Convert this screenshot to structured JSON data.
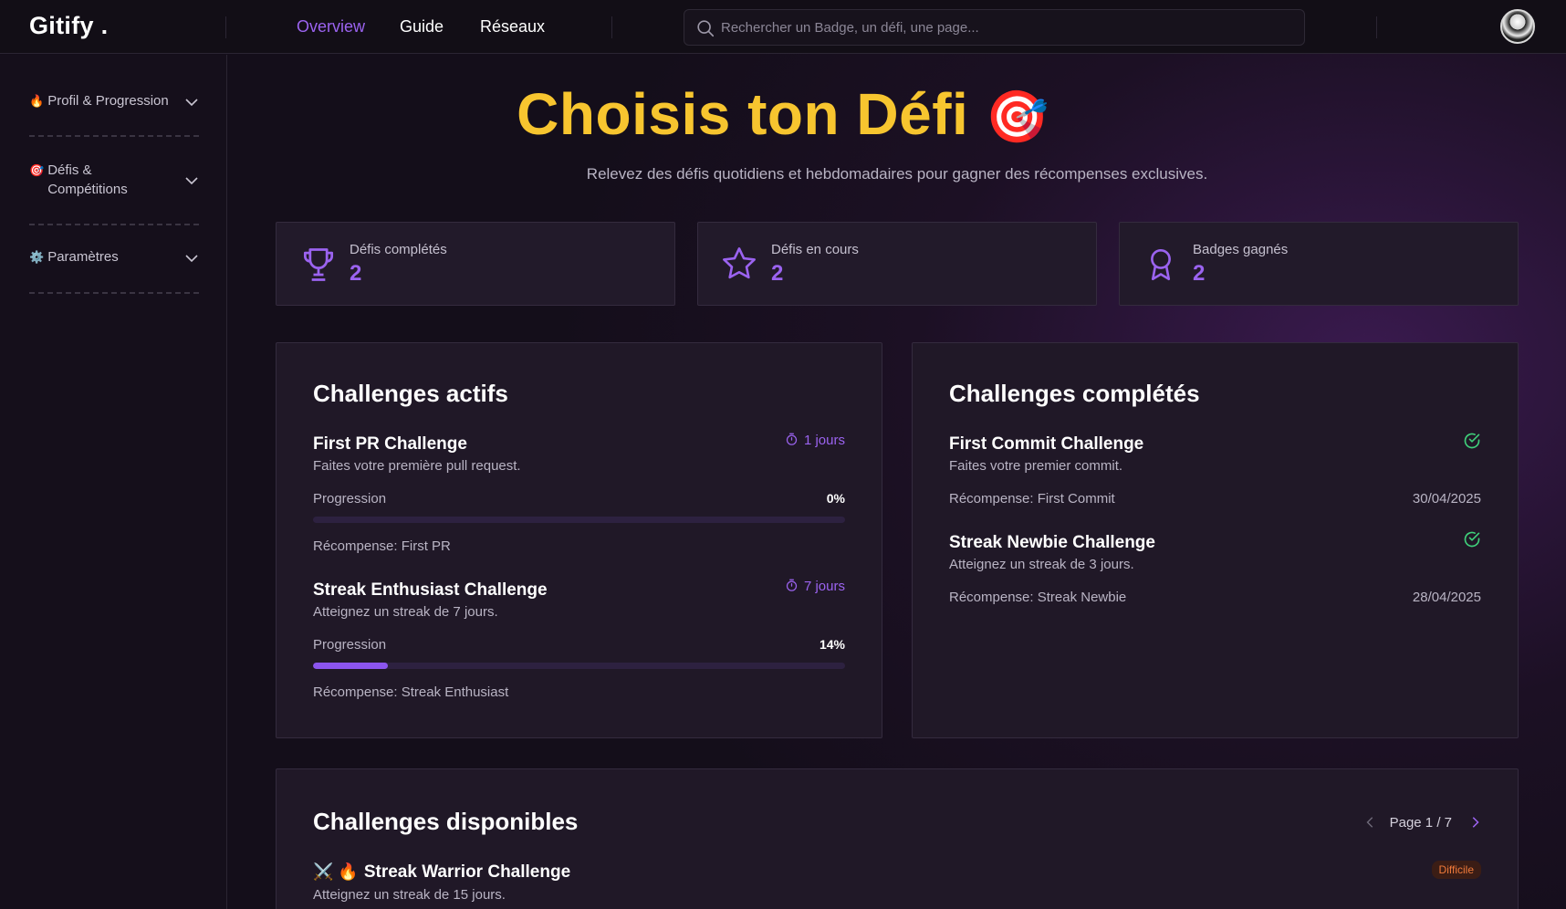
{
  "app": {
    "logo": "Gitify ."
  },
  "nav": {
    "items": [
      {
        "label": "Overview",
        "active": true
      },
      {
        "label": "Guide"
      },
      {
        "label": "Réseaux"
      }
    ]
  },
  "search": {
    "placeholder": "Rechercher un Badge, un défi, une page..."
  },
  "sidebar": {
    "items": [
      {
        "emoji": "🔥",
        "label": "Profil & Progression"
      },
      {
        "emoji": "🎯",
        "label": "Défis & Compétitions"
      },
      {
        "emoji": "⚙️",
        "label": "Paramètres"
      }
    ]
  },
  "hero": {
    "title": "Choisis ton Défi",
    "emoji": "🎯",
    "subtitle": "Relevez des défis quotidiens et hebdomadaires pour gagner des récompenses exclusives."
  },
  "stats": [
    {
      "icon": "trophy-icon",
      "label": "Défis complétés",
      "value": "2"
    },
    {
      "icon": "star-icon",
      "label": "Défis en cours",
      "value": "2"
    },
    {
      "icon": "ribbon-icon",
      "label": "Badges gagnés",
      "value": "2"
    }
  ],
  "active": {
    "title": "Challenges actifs",
    "items": [
      {
        "title": "First PR Challenge",
        "desc": "Faites votre première pull request.",
        "days": "1 jours",
        "progress_label": "Progression",
        "progress": "0%",
        "progress_value": 0,
        "reward": "Récompense: First PR"
      },
      {
        "title": "Streak Enthusiast Challenge",
        "desc": "Atteignez un streak de 7 jours.",
        "days": "7 jours",
        "progress_label": "Progression",
        "progress": "14%",
        "progress_value": 14,
        "reward": "Récompense: Streak Enthusiast"
      }
    ]
  },
  "completed": {
    "title": "Challenges complétés",
    "items": [
      {
        "title": "First Commit Challenge",
        "desc": "Faites votre premier commit.",
        "reward": "Récompense: First Commit",
        "date": "30/04/2025"
      },
      {
        "title": "Streak Newbie Challenge",
        "desc": "Atteignez un streak de 3 jours.",
        "reward": "Récompense: Streak Newbie",
        "date": "28/04/2025"
      }
    ]
  },
  "available": {
    "title": "Challenges disponibles",
    "page": "Page 1 / 7",
    "items": [
      {
        "emojis": "⚔️ 🔥",
        "title": "Streak Warrior Challenge",
        "desc": "Atteignez un streak de 15 jours.",
        "difficulty": "Difficile"
      }
    ]
  },
  "colors": {
    "accent": "#9b63f0",
    "gold": "#f7c52f",
    "success": "#3fcf7a",
    "hard": "#f07a3a"
  }
}
